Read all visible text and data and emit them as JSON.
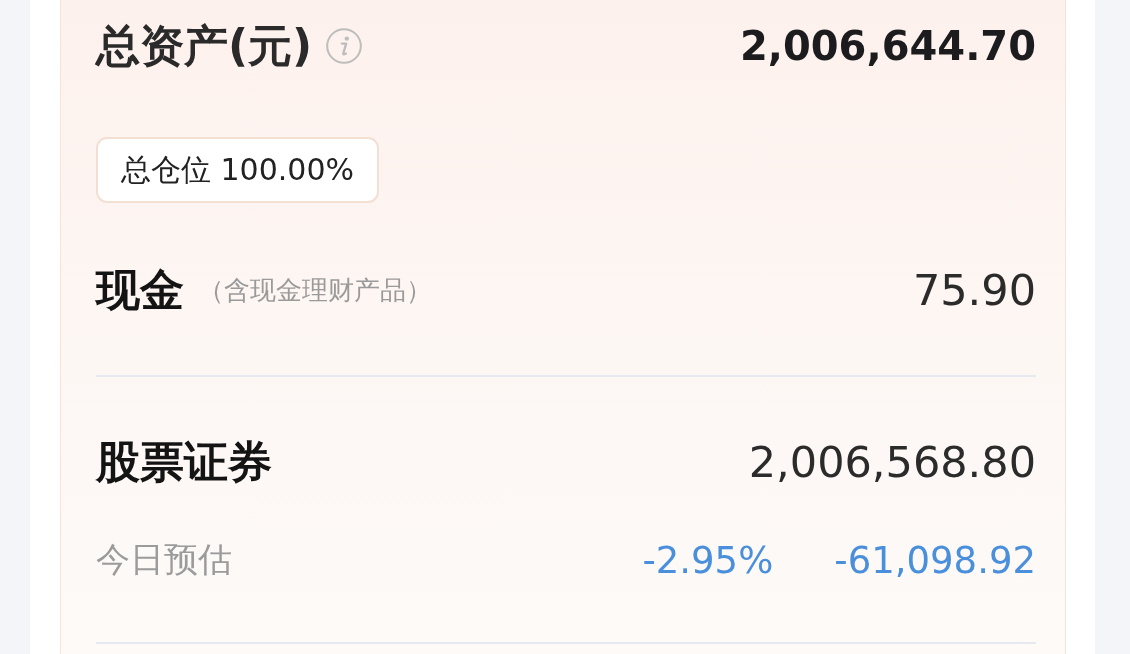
{
  "total_assets": {
    "label": "总资产(元)",
    "value": "2,006,644.70"
  },
  "position_badge": "总仓位 100.00%",
  "rows": [
    {
      "kind": "cash",
      "label": "现金",
      "note": "（含现金理财产品）",
      "value": "75.90"
    },
    {
      "kind": "securities",
      "label": "股票证券",
      "value": "2,006,568.80",
      "today_estimate": {
        "label": "今日预估",
        "percent": "-2.95%",
        "amount": "-61,098.92"
      }
    }
  ]
}
